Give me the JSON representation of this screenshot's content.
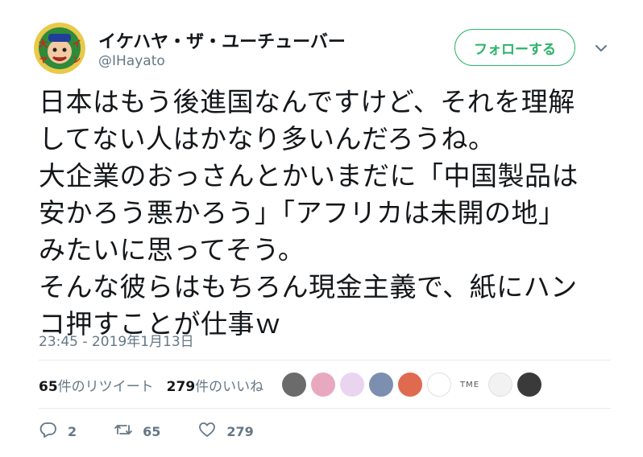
{
  "user": {
    "display_name": "イケハヤ・ザ・ユーチューバー",
    "handle": "@IHayato"
  },
  "follow_button": {
    "label": "フォローする"
  },
  "tweet": {
    "text": "日本はもう後進国なんですけど、それを理解\nしてない人はかなり多いんだろうね。\n大企業のおっさんとかいまだに「中国製品は\n安かろう悪かろう」「アフリカは未開の地」\nみたいに思ってそう。\nそんな彼らはもちろん現金主義で、紙にハン\nコ押すことが仕事ｗ",
    "timestamp": "23:45 - 2019年1月13日"
  },
  "stats": {
    "retweets_count": "65",
    "retweets_label": "件のリツイート",
    "likes_count": "279",
    "likes_label": "件のいいね"
  },
  "liker_avatars": [
    {
      "color": "#6b6b6b"
    },
    {
      "color": "#e8a9c0"
    },
    {
      "color": "#e9d5ef"
    },
    {
      "color": "#7c8fb0"
    },
    {
      "color": "#e06a4f"
    },
    {
      "color": "#ffffff"
    },
    {
      "color": "#ffffff",
      "text": "TME"
    },
    {
      "color": "#f2f2f2"
    },
    {
      "color": "#3a3a3a"
    }
  ],
  "actions": {
    "reply_count": "2",
    "retweet_count": "65",
    "like_count": "279"
  },
  "colors": {
    "follow_green": "#2db36a",
    "secondary_text": "#657786",
    "divider": "#e6ecf0"
  },
  "icons": [
    "reply-icon",
    "retweet-icon",
    "heart-icon",
    "chevron-down-icon"
  ]
}
